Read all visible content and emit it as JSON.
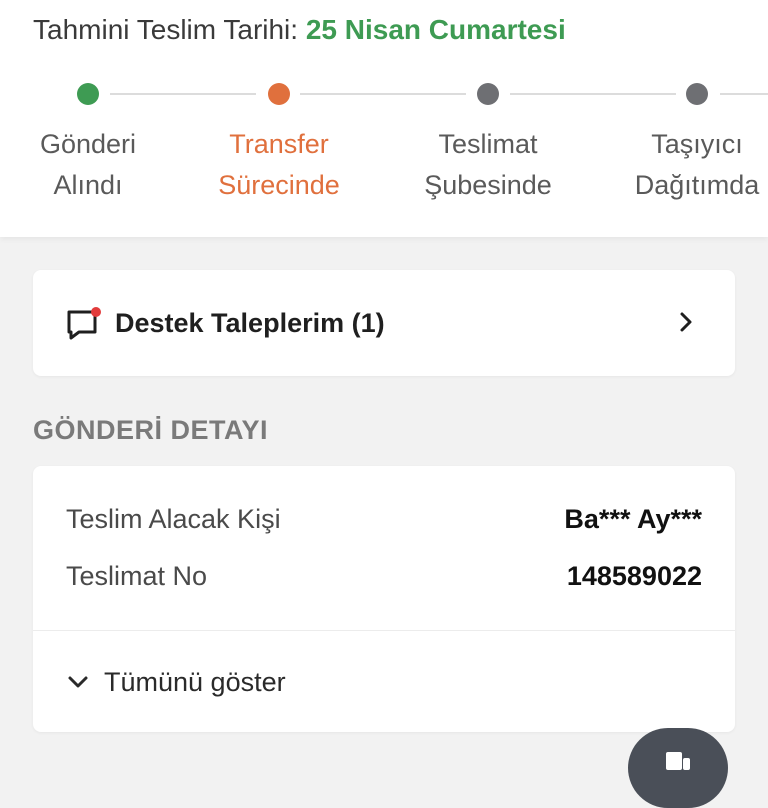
{
  "header": {
    "eta_label": "Tahmini Teslim Tarihi:",
    "eta_value": "25 Nisan Cumartesi",
    "eta_color": "#3e9b53"
  },
  "tracking": {
    "steps": [
      {
        "line1": "Gönderi",
        "line2": "Alındı",
        "status": "done",
        "color": "#3e9b53"
      },
      {
        "line1": "Transfer",
        "line2": "Sürecinde",
        "status": "current",
        "color": "#e0703d"
      },
      {
        "line1": "Teslimat",
        "line2": "Şubesinde",
        "status": "pending",
        "color": "#6e6f73"
      },
      {
        "line1": "Taşıyıcı",
        "line2": "Dağıtımda",
        "status": "pending",
        "color": "#6e6f73"
      }
    ]
  },
  "support": {
    "label": "Destek Taleplerim (1)",
    "icon": "chat-bubble-icon",
    "notification_color": "#e23b3b"
  },
  "shipment_detail": {
    "section_title": "GÖNDERİ DETAYI",
    "rows": [
      {
        "key": "Teslim Alacak Kişi",
        "value": "Ba*** Ay***"
      },
      {
        "key": "Teslimat No",
        "value": "148589022"
      }
    ],
    "show_all_label": "Tümünü göster"
  },
  "fab": {
    "icon": "chat-icon",
    "color": "#4a4f58"
  }
}
